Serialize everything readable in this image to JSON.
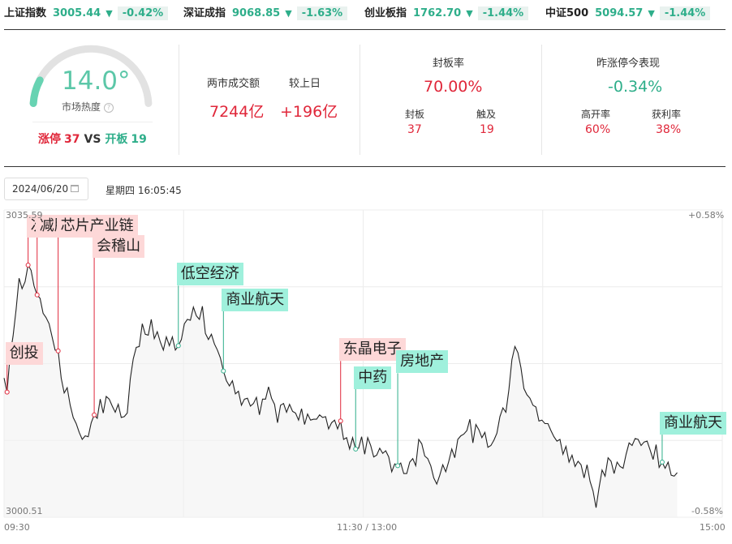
{
  "ticker": [
    {
      "name": "上证指数",
      "value": "3005.44",
      "arrow": "▼",
      "change": "-0.42%"
    },
    {
      "name": "深证成指",
      "value": "9068.85",
      "arrow": "▼",
      "change": "-1.63%"
    },
    {
      "name": "创业板指",
      "value": "1762.70",
      "arrow": "▼",
      "change": "-1.44%"
    },
    {
      "name": "中证500",
      "value": "5094.57",
      "arrow": "▼",
      "change": "-1.44%"
    }
  ],
  "gauge": {
    "value": "14.0°",
    "level": 0.14,
    "label": "市场热度",
    "info_icon": "info-circle-icon"
  },
  "limit": {
    "up_label": "涨停",
    "up_count": "37",
    "vs": "VS",
    "open_label": "开板",
    "open_count": "19"
  },
  "turnover": {
    "label": "两市成交额",
    "value": "7244亿",
    "compare_label": "较上日",
    "compare_value": "+196亿"
  },
  "seal": {
    "title": "封板率",
    "rate": "70.00%",
    "sealed_label": "封板",
    "sealed": "37",
    "touched_label": "触及",
    "touched": "19"
  },
  "yesterday": {
    "title": "昨涨停今表现",
    "value": "-0.34%",
    "high_open_label": "高开率",
    "high_open": "60%",
    "profit_label": "获利率",
    "profit": "38%"
  },
  "date": {
    "value": "2024/06/20",
    "icon": "calendar-icon",
    "weekday": "星期四 16:05:45"
  },
  "colors": {
    "up": "#e0273a",
    "down": "#2eae8a",
    "pink_tag": "#fdd8d8",
    "teal_tag": "#9ff0dc"
  },
  "chart_data": {
    "type": "line",
    "y_top": "3035.59",
    "y_bottom": "3000.51",
    "ylim": [
      3000.51,
      3035.59
    ],
    "right_top": "+0.58%",
    "right_bottom": "-0.58%",
    "x_labels": [
      "09:30",
      "11:30 / 13:00",
      "15:00"
    ],
    "sessions": 240,
    "values": [
      3016.4,
      3014.8,
      3019.0,
      3021.2,
      3024.2,
      3027.8,
      3026.6,
      3027.4,
      3029.3,
      3028.7,
      3026.9,
      3025.9,
      3025.5,
      3023.8,
      3023.3,
      3022.6,
      3021.1,
      3019.6,
      3019.5,
      3016.4,
      3014.7,
      3015.3,
      3013.3,
      3011.9,
      3011.2,
      3010.2,
      3009.4,
      3009.8,
      3009.7,
      3011.3,
      3012.2,
      3011.8,
      3014.0,
      3012.4,
      3014.3,
      3014.0,
      3013.2,
      3012.5,
      3013.4,
      3011.9,
      3012.0,
      3012.4,
      3016.3,
      3018.6,
      3019.9,
      3020.0,
      3022.6,
      3021.4,
      3021.3,
      3023.1,
      3020.9,
      3021.7,
      3020.5,
      3019.6,
      3021.1,
      3020.1,
      3021.1,
      3019.6,
      3020.1,
      3020.8,
      3022.6,
      3023.1,
      3023.0,
      3024.5,
      3023.5,
      3023.1,
      3024.6,
      3021.5,
      3020.8,
      3021.4,
      3020.3,
      3019.6,
      3018.7,
      3017.2,
      3016.1,
      3015.5,
      3016.1,
      3014.6,
      3014.9,
      3013.3,
      3014.0,
      3014.1,
      3013.2,
      3013.5,
      3014.2,
      3012.2,
      3014.0,
      3014.0,
      3015.4,
      3014.1,
      3013.4,
      3011.3,
      3013.3,
      3013.5,
      3012.5,
      3013.4,
      3012.6,
      3012.4,
      3011.6,
      3012.9,
      3011.1,
      3012.3,
      3011.6,
      3011.7,
      3011.7,
      3012.2,
      3011.9,
      3012.0,
      3010.6,
      3011.3,
      3011.6,
      3010.6,
      3011.5,
      3009.4,
      3009.6,
      3008.3,
      3009.6,
      3008.3,
      3008.4,
      3009.7,
      3007.7,
      3009.6,
      3008.7,
      3007.4,
      3007.6,
      3008.4,
      3007.8,
      3008.1,
      3007.4,
      3005.7,
      3006.6,
      3006.4,
      3006.7,
      3005.5,
      3005.5,
      3006.8,
      3007.2,
      3006.4,
      3009.4,
      3008.9,
      3007.5,
      3007.2,
      3006.4,
      3005.0,
      3004.3,
      3005.3,
      3006.5,
      3005.7,
      3006.9,
      3008.3,
      3007.3,
      3009.4,
      3009.8,
      3010.0,
      3010.4,
      3011.7,
      3009.0,
      3011.1,
      3010.5,
      3009.6,
      3010.2,
      3008.5,
      3008.7,
      3009.3,
      3010.1,
      3012.0,
      3013.0,
      3012.5,
      3015.1,
      3018.5,
      3020.0,
      3019.3,
      3017.6,
      3015.2,
      3014.5,
      3014.1,
      3013.3,
      3013.1,
      3011.5,
      3011.6,
      3011.2,
      3011.2,
      3010.4,
      3009.7,
      3009.2,
      3009.4,
      3007.7,
      3008.6,
      3006.8,
      3007.6,
      3006.3,
      3006.9,
      3006.5,
      3005.0,
      3006.5,
      3004.6,
      3003.5,
      3001.6,
      3003.9,
      3005.9,
      3005.2,
      3007.3,
      3006.9,
      3005.5,
      3006.8,
      3006.3,
      3006.1,
      3007.7,
      3009.0,
      3008.7,
      3009.5,
      3009.4,
      3008.7,
      3009.1,
      3009.2,
      3008.2,
      3007.1,
      3008.8,
      3006.2,
      3006.8,
      3006.1,
      3006.8,
      3005.3,
      3005.2,
      3005.6
    ],
    "markers": [
      {
        "label": "创投",
        "style": "pink",
        "i": 1
      },
      {
        "label": "次新股",
        "style": "pink",
        "i": 8
      },
      {
        "label": "减肥药",
        "style": "pink",
        "i": 11
      },
      {
        "label": "芯片产业链",
        "style": "pink",
        "i": 18
      },
      {
        "label": "会稽山",
        "style": "pink",
        "i": 30
      },
      {
        "label": "低空经济",
        "style": "teal",
        "i": 58
      },
      {
        "label": "商业航天",
        "style": "teal",
        "i": 73
      },
      {
        "label": "东晶电子",
        "style": "pink",
        "i": 112
      },
      {
        "label": "中药",
        "style": "teal",
        "i": 117
      },
      {
        "label": "房地产",
        "style": "teal",
        "i": 131
      },
      {
        "label": "商业航天",
        "style": "teal",
        "i": 219
      }
    ]
  }
}
